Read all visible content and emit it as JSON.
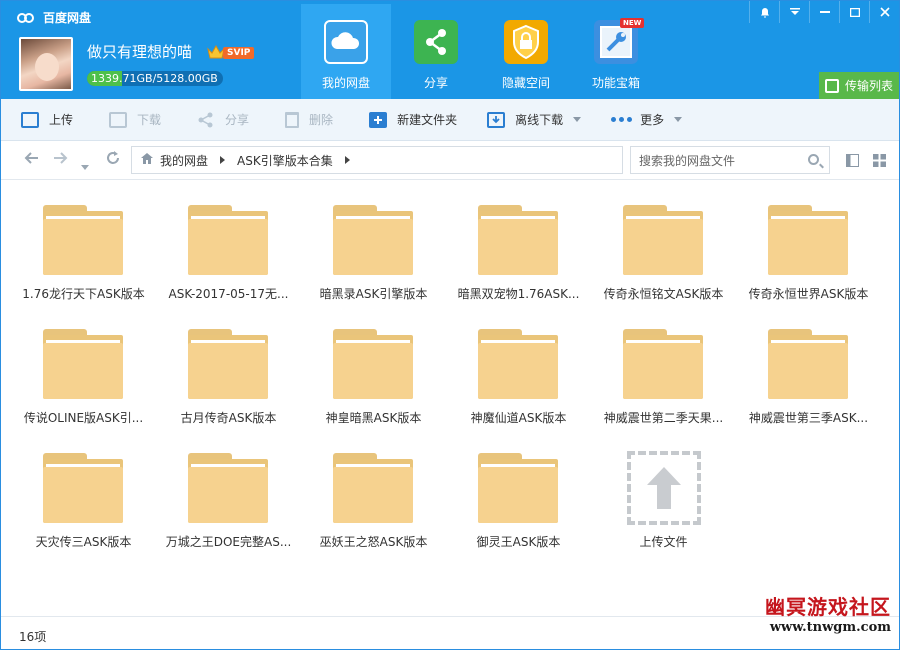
{
  "app": {
    "title": "百度网盘"
  },
  "user": {
    "name": "做只有理想的喵",
    "badge": "SVIP",
    "quota_used": "1339.",
    "quota_text": "71GB/5128.00GB",
    "quota_fraction": 0.261
  },
  "nav": {
    "tabs": [
      {
        "label": "我的网盘",
        "icon": "cloud-icon",
        "active": true
      },
      {
        "label": "分享",
        "icon": "share-icon",
        "active": false
      },
      {
        "label": "隐藏空间",
        "icon": "lock-icon",
        "active": false
      },
      {
        "label": "功能宝箱",
        "icon": "wrench-icon",
        "active": false
      }
    ],
    "new_badge": "NEW",
    "transfer_label": "传输列表"
  },
  "toolbar": {
    "upload": "上传",
    "download": "下载",
    "share": "分享",
    "delete": "删除",
    "new_folder": "新建文件夹",
    "offline_download": "离线下载",
    "more": "更多"
  },
  "address": {
    "crumbs": [
      "我的网盘",
      "ASK引擎版本合集"
    ],
    "search_placeholder": "搜索我的网盘文件"
  },
  "files": [
    "1.76龙行天下ASK版本",
    "ASK-2017-05-17无...",
    "暗黑录ASK引擎版本",
    "暗黑双宠物1.76ASK...",
    "传奇永恒铭文ASK版本",
    "传奇永恒世界ASK版本",
    "传说OLINE版ASK引...",
    "古月传奇ASK版本",
    "神皇暗黑ASK版本",
    "神魔仙道ASK版本",
    "神威震世第二季天果...",
    "神威震世第三季ASK...",
    "天灾传三ASK版本",
    "万城之王DOE完整AS...",
    "巫妖王之怒ASK版本",
    "御灵王ASK版本"
  ],
  "upload_tile": "上传文件",
  "status": {
    "count": "16项"
  },
  "watermark": {
    "line1": "幽冥游戏社区",
    "line2": "www.tnwgm.com"
  },
  "colors": {
    "header": "#1b96e6",
    "active_tab": "#2fa7f2",
    "transfer": "#59b84a",
    "folder": "#f6d28f"
  }
}
